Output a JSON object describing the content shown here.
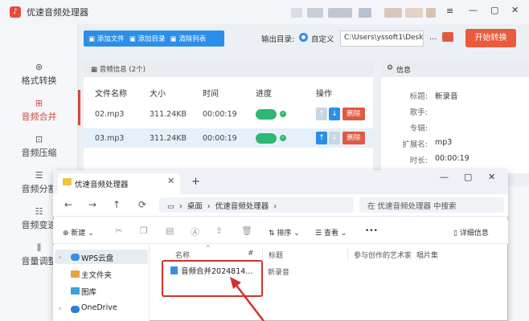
{
  "app": {
    "title": "优速音频处理器",
    "logo": "♪",
    "blur_colors": [
      "#d8dde4",
      "#c8ced6",
      "#bfc6cf",
      "#b7c2cf",
      "#d9c8b8",
      "#e2d3c6",
      "#d8c2b0"
    ],
    "window_controls": [
      "—",
      "▢",
      "✕"
    ]
  },
  "nav": [
    {
      "icon": "⊛",
      "label": "格式转换"
    },
    {
      "icon": "⊞",
      "label": "音频合并"
    },
    {
      "icon": "⊡",
      "label": "音频压缩"
    },
    {
      "icon": "☰",
      "label": "音频分割"
    },
    {
      "icon": "☷",
      "label": "音频变速"
    },
    {
      "icon": "⫼",
      "label": "音量调整"
    }
  ],
  "toolbar": {
    "add_file": "添加文件",
    "add_dir": "添加目录",
    "clear": "清除列表"
  },
  "output": {
    "label": "输出目录:",
    "option": "自定义",
    "path": "C:\\Users\\yssoft1\\Deskt",
    "more": "...",
    "start": "开始转换"
  },
  "filelist": {
    "title": "音频信息 (2个)",
    "columns": [
      "文件名称",
      "大小",
      "时间",
      "进度",
      "操作"
    ],
    "rows": [
      {
        "name": "02.mp3",
        "size": "311.24KB",
        "time": "00:00:19",
        "delete": "删除"
      },
      {
        "name": "03.mp3",
        "size": "311.24KB",
        "time": "00:00:19",
        "delete": "删除"
      }
    ]
  },
  "info": {
    "title": "信息",
    "fields": [
      {
        "label": "标题:",
        "value": "新录音"
      },
      {
        "label": "歌手:",
        "value": ""
      },
      {
        "label": "专辑:",
        "value": ""
      },
      {
        "label": "扩展名:",
        "value": "mp3"
      },
      {
        "label": "时长:",
        "value": "00:00:19"
      }
    ]
  },
  "explorer": {
    "tab_title": "优速音频处理器",
    "tab_close": "✕",
    "tab_add": "+",
    "controls": [
      "—",
      "▢",
      "✕"
    ],
    "nav": [
      "←",
      "→",
      "↑",
      "⟳"
    ],
    "breadcrumb": [
      "桌面",
      "优速音频处理器"
    ],
    "search_placeholder": "在 优速音频处理器 中搜索",
    "commands": {
      "new": "新建",
      "sort": "排序",
      "view": "查看",
      "more": "•••",
      "details": "详细信息"
    },
    "sidebar": [
      "WPS云盘",
      "主文件夹",
      "图库",
      "OneDrive"
    ],
    "columns": [
      "名称",
      "#",
      "标题",
      "参与创作的艺术家",
      "唱片集"
    ],
    "file": {
      "name": "音频合并2024814...",
      "title": "新录音"
    }
  }
}
